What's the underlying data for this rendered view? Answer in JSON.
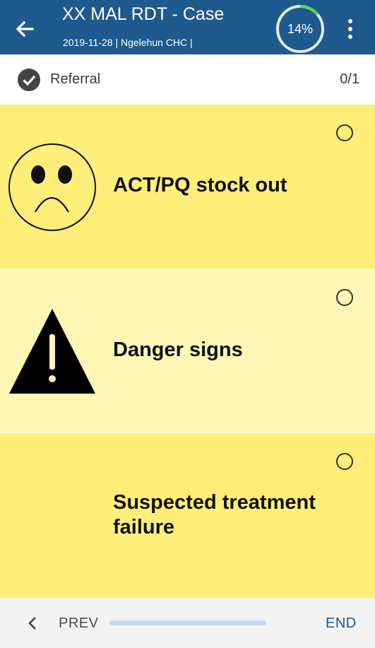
{
  "header": {
    "title": "XX MAL RDT - Case",
    "subtitle": "2019-11-28 | Ngelehun CHC |",
    "progress_label": "14%",
    "progress_fraction": 0.14,
    "color": "#1e5a8e"
  },
  "section": {
    "label": "Referral",
    "count": "0/1"
  },
  "options": [
    {
      "label": "ACT/PQ stock out",
      "icon": "sad-face-icon",
      "selected": false,
      "color": "#ffee7a"
    },
    {
      "label": "Danger signs",
      "icon": "warning-icon",
      "selected": false,
      "color": "#fff6b5"
    },
    {
      "label": "Suspected treatment failure",
      "icon": "",
      "selected": false,
      "color": "#ffee7a"
    }
  ],
  "navigation": {
    "prev_label": "PREV",
    "end_label": "END"
  }
}
